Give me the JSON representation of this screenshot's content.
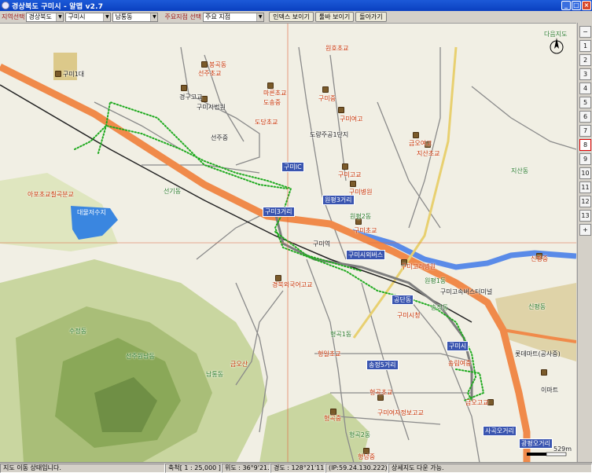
{
  "window": {
    "title": "경상북도 구미시 - 알맵 v2.7"
  },
  "toolbar": {
    "region_label": "지역선택",
    "province": "경상북도",
    "city": "구미시",
    "district": "남통동",
    "poi_label": "주요지점 선택",
    "poi_value": "주요 지점",
    "index_button": "인덱스 보이기",
    "bar_button": "툴바 보이기",
    "back_button": "돌아가기"
  },
  "map": {
    "compass": "N",
    "legend_top_right": "다음지도",
    "scale_text": "529m",
    "labels": {
      "gumi_1dae": "구미1대",
      "bokgok": "봉곡동",
      "seonju_cho": "선주초교",
      "gyeonggu": "경구고교",
      "gumi_court": "구미시법원",
      "seonju_jung": "선주중",
      "wonho_cho": "원호초교",
      "dosong_cho": "마른초교",
      "dosong": "도송중",
      "dodang_cho": "도당초교",
      "gumi_jung": "구미중",
      "gumi_yeogo": "구미여고",
      "dodang_apt": "도량주공1단지",
      "geumo_yeogo": "금오여고",
      "jisan_cho": "지산초교",
      "gumi_gogyo": "구미고교",
      "gumi_hosp": "구미병원",
      "jisan_dong": "지산동",
      "apo": "아포초교칠곡분교",
      "dalmun_lake": "대물저수지",
      "seongi": "선기동",
      "wonpyeong2": "원평2동",
      "gumi_cho": "구미초교",
      "gumi_sta": "구미역",
      "gumi_bus": "구미시외버스",
      "gumi_cross": "구미3거리",
      "gyeongbuk_hs": "경북외국어고교",
      "gumi_medical": "구미고려병원",
      "sinpyeong": "신평중",
      "sinpyeong2": "신평동",
      "wonpyeong1": "원평1동",
      "bus_terminal": "구미고속버스터미널",
      "songjeong": "송정동",
      "gumi_city": "구미시청",
      "gumi_si": "구미시",
      "hyeonggok1": "형곡1동",
      "hyeongil_cho": "형일초교",
      "sujeong": "수정동",
      "seonju_park": "선주원남동",
      "namtong": "남통동",
      "geumo_mt": "금오산",
      "songnim": "송림여중",
      "lotte_mart": "롯데마트(공사중)",
      "geumo_go": "금오고교",
      "emart": "이마트",
      "hyeonggok_cho": "형곡초교",
      "hyeonggok_jung": "형곡중",
      "gumi_girls_info": "구미여자정보고교",
      "hyeonggok2": "형곡2동",
      "hyeongnam": "형남중",
      "songjeong_cross": "송정5거리",
      "sagok": "사곡오거리",
      "gwangpyeong": "광평오거리",
      "gongdan": "공단동",
      "ic": "구미IC",
      "wonpyeong_apt": "원평3거리"
    }
  },
  "zoom": {
    "up": "−",
    "levels": [
      "1",
      "2",
      "3",
      "4",
      "5",
      "6",
      "7",
      "8",
      "9",
      "10",
      "11",
      "12",
      "13"
    ],
    "selected": "8",
    "plus": "+"
  },
  "status": {
    "move": "지도 이동 상태입니다.",
    "scale": "축척[ 1 : 25,000 ]",
    "lat": "위도 : 36°9'21.79\"",
    "lon": "경도 : 128°21'11.92\"",
    "ip": "(IP:59.24.130.222)",
    "hint": "상세지도 다운 가능."
  },
  "colors": {
    "highway": "#f08a4a",
    "river": "#5a8be8",
    "route": "#1faa1f",
    "mountain": "#8aa858",
    "railway": "#222222"
  }
}
